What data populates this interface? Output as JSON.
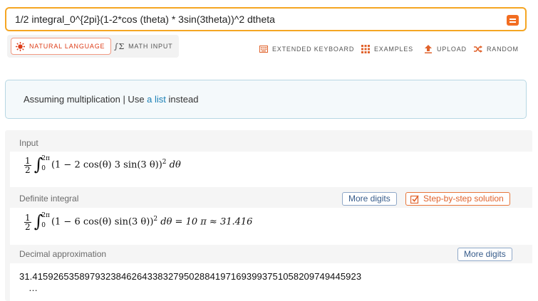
{
  "search": {
    "query": "1/2 integral_0^{2pi}(1-2*cos (theta) * 3sin(3theta))^2 dtheta"
  },
  "mode": {
    "natural_language": "NATURAL LANGUAGE",
    "math_input": "MATH INPUT"
  },
  "toolbar": {
    "extended_keyboard": "EXTENDED KEYBOARD",
    "examples": "EXAMPLES",
    "upload": "UPLOAD",
    "random": "RANDOM"
  },
  "assumption": {
    "prefix": "Assuming multiplication | Use ",
    "link": "a list",
    "suffix": " instead"
  },
  "pods": {
    "input": {
      "title": "Input",
      "expr": {
        "num": "1",
        "den": "2",
        "lower": "0",
        "upper": "2π",
        "body": "(1 − 2 cos(θ) 3 sin(3 θ))",
        "power": "2",
        "diff": " dθ"
      }
    },
    "definite_integral": {
      "title": "Definite integral",
      "more_digits": "More digits",
      "step_by_step": "Step-by-step solution",
      "expr": {
        "num": "1",
        "den": "2",
        "lower": "0",
        "upper": "2π",
        "body": "(1 − 6 cos(θ) sin(3 θ))",
        "power": "2",
        "rest": " dθ = 10 π ≈ 31.416"
      }
    },
    "decimal": {
      "title": "Decimal approximation",
      "more_digits": "More digits",
      "value": "31.415926535897932384626433832795028841971693993751058209749445923",
      "ellipsis": "…"
    }
  },
  "colors": {
    "accent": "#f5a623",
    "brand": "#dd3b16",
    "link": "#1a7fb5"
  }
}
